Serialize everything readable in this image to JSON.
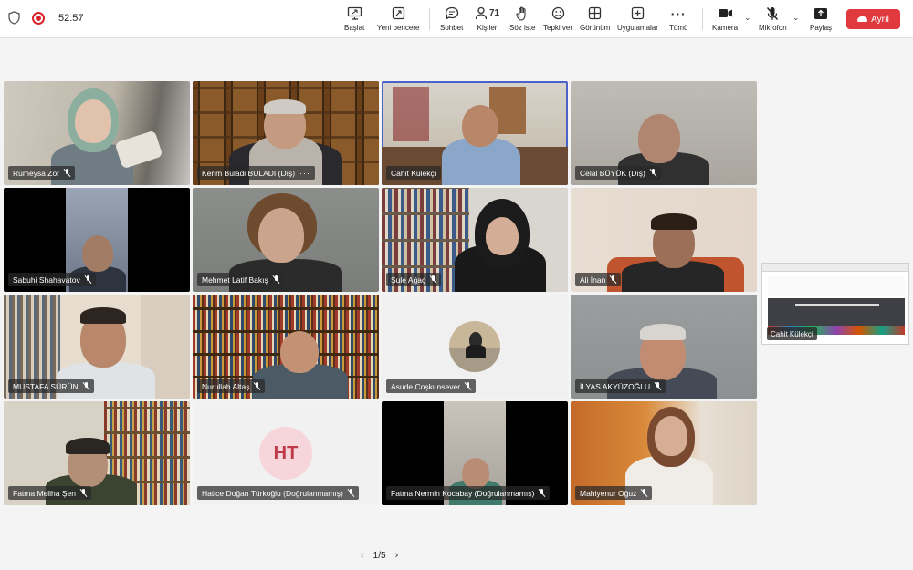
{
  "status": {
    "timer": "52:57",
    "shield_icon": "shield-icon",
    "record_icon": "recording-indicator-icon"
  },
  "toolbar": {
    "start": {
      "label": "Başlat",
      "icon": "screen-share-icon"
    },
    "new_window": {
      "label": "Yeni pencere",
      "icon": "new-window-icon"
    },
    "chat": {
      "label": "Sohbet",
      "icon": "chat-bubble-icon"
    },
    "people": {
      "label": "Kişiler",
      "count": "71",
      "icon": "people-icon"
    },
    "raise_hand": {
      "label": "Söz iste",
      "icon": "hand-icon"
    },
    "react": {
      "label": "Tepki ver",
      "icon": "smiley-icon"
    },
    "view": {
      "label": "Görünüm",
      "icon": "grid-view-icon"
    },
    "apps": {
      "label": "Uygulamalar",
      "icon": "plus-square-icon"
    },
    "more": {
      "label": "Tümü",
      "icon": "ellipsis-icon"
    },
    "camera": {
      "label": "Kamera",
      "icon": "video-camera-icon"
    },
    "mic": {
      "label": "Mikrofon",
      "icon": "mic-off-icon"
    },
    "share": {
      "label": "Paylaş",
      "icon": "share-upload-icon"
    },
    "leave": {
      "label": "Ayrıl",
      "color": "#e0393e"
    }
  },
  "participants": [
    {
      "name": "Rumeysa Zor",
      "muted": true
    },
    {
      "name": "Kerim Buladi BULADI (Dış)",
      "muted": true,
      "more": "···"
    },
    {
      "name": "Cahit Külekçi",
      "muted": false,
      "active_speaker": true
    },
    {
      "name": "Celal BÜYÜK (Dış)",
      "muted": true
    },
    {
      "name": "Sabuhi Shahavatov",
      "muted": true
    },
    {
      "name": "Mehmet Latif Bakış",
      "muted": true
    },
    {
      "name": "Şule Ağaç",
      "muted": true
    },
    {
      "name": "Ali İnan",
      "muted": true
    },
    {
      "name": "MUSTAFA SÜRÜN",
      "muted": true
    },
    {
      "name": "Nurullah Altaş",
      "muted": true
    },
    {
      "name": "Asude Coşkunsever",
      "muted": true,
      "avatar": "photo"
    },
    {
      "name": "İLYAS AKYÜZOĞLU",
      "muted": true
    },
    {
      "name": "Fatma Meliha Şen",
      "muted": true
    },
    {
      "name": "Hatice Doğan Türkoğlu (Doğrulanmamış)",
      "muted": true,
      "initials": "HT"
    },
    {
      "name": "Fatma Nermin Kocabay (Doğrulanmamış)",
      "muted": true
    },
    {
      "name": "Mahiyenur Oğuz",
      "muted": true
    }
  ],
  "shared_screen": {
    "presenter": "Cahit Külekçi"
  },
  "pagination": {
    "text": "1/5"
  },
  "colors": {
    "accent": "#4b63c9",
    "leave": "#e0393e",
    "initials_bg": "#f6d6da",
    "initials_fg": "#c0394a"
  }
}
